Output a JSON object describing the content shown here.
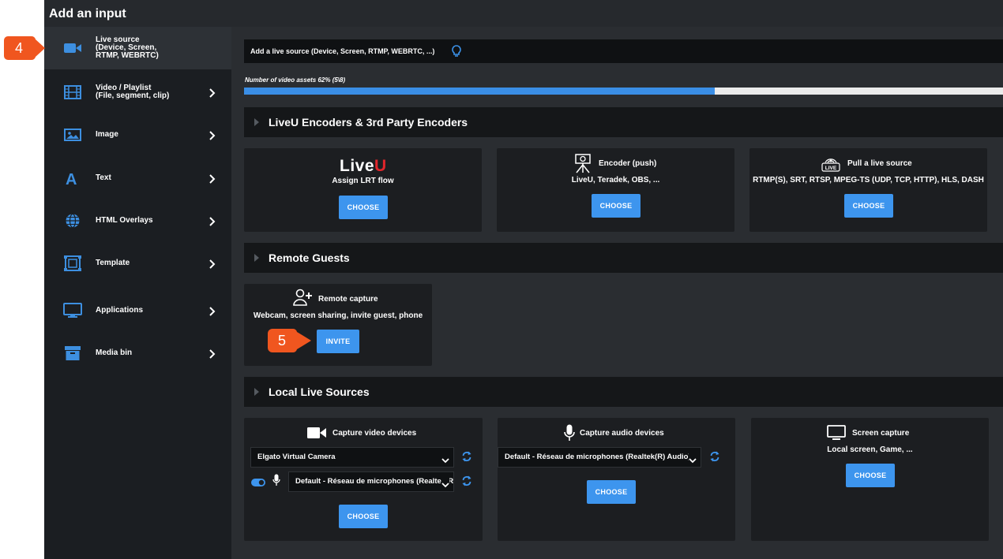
{
  "window": {
    "title": "Add an input"
  },
  "sidebar": {
    "items": [
      {
        "label_lines": [
          "Live source",
          "(Device, Screen,",
          "RTMP, WEBRTC)"
        ],
        "icon": "video-camera-icon",
        "active": true
      },
      {
        "label_lines": [
          "Video / Playlist",
          "(File, segment, clip)"
        ],
        "icon": "film-icon"
      },
      {
        "label_lines": [
          "Image"
        ],
        "icon": "image-icon"
      },
      {
        "label_lines": [
          "Text"
        ],
        "icon": "text-icon"
      },
      {
        "label_lines": [
          "HTML Overlays"
        ],
        "icon": "globe-icon"
      },
      {
        "label_lines": [
          "Template"
        ],
        "icon": "template-icon"
      },
      {
        "label_lines": [
          "Applications"
        ],
        "icon": "monitor-icon"
      },
      {
        "label_lines": [
          "Media bin"
        ],
        "icon": "archive-icon"
      }
    ]
  },
  "main": {
    "add_bar_text": "Add a live source (Device, Screen, RTMP, WEBRTC, ...)",
    "progress": {
      "label": "Number of video assets 62% (5\\8)",
      "value": 0.62
    },
    "sections": {
      "liveu": {
        "title": "LiveU Encoders & 3rd Party Encoders",
        "cards": {
          "liveu": {
            "logo": "LiveU",
            "subtitle": "Assign LRT flow",
            "button": "CHOOSE"
          },
          "encoder": {
            "title": "Encoder (push)",
            "subtitle": "LiveU, Teradek, OBS, ...",
            "button": "CHOOSE"
          },
          "pull": {
            "title": "Pull a live source",
            "subtitle": "RTMP(S), SRT, RTSP, MPEG-TS (UDP, TCP, HTTP), HLS, DASH",
            "button": "CHOOSE",
            "icon_text": "LIVE"
          }
        }
      },
      "guests": {
        "title": "Remote Guests",
        "cards": {
          "remote": {
            "title": "Remote capture",
            "subtitle": "Webcam, screen sharing, invite guest, phone",
            "button": "INVITE"
          }
        }
      },
      "local": {
        "title": "Local Live Sources",
        "cards": {
          "video": {
            "title": "Capture video devices",
            "device": "Elgato Virtual Camera",
            "audio": "Default - Réseau de microphones (Realtek(R) Audio)",
            "button": "CHOOSE"
          },
          "audio": {
            "title": "Capture audio devices",
            "device": "Default - Réseau de microphones (Realtek(R) Audio)",
            "button": "CHOOSE"
          },
          "screen": {
            "title": "Screen capture",
            "subtitle": "Local screen, Game, ...",
            "button": "CHOOSE"
          }
        }
      }
    }
  },
  "callouts": {
    "step4": "4",
    "step5": "5"
  },
  "colors": {
    "accent": "#3d95ee",
    "callout": "#f0561f",
    "liveu_red": "#e0252b"
  }
}
